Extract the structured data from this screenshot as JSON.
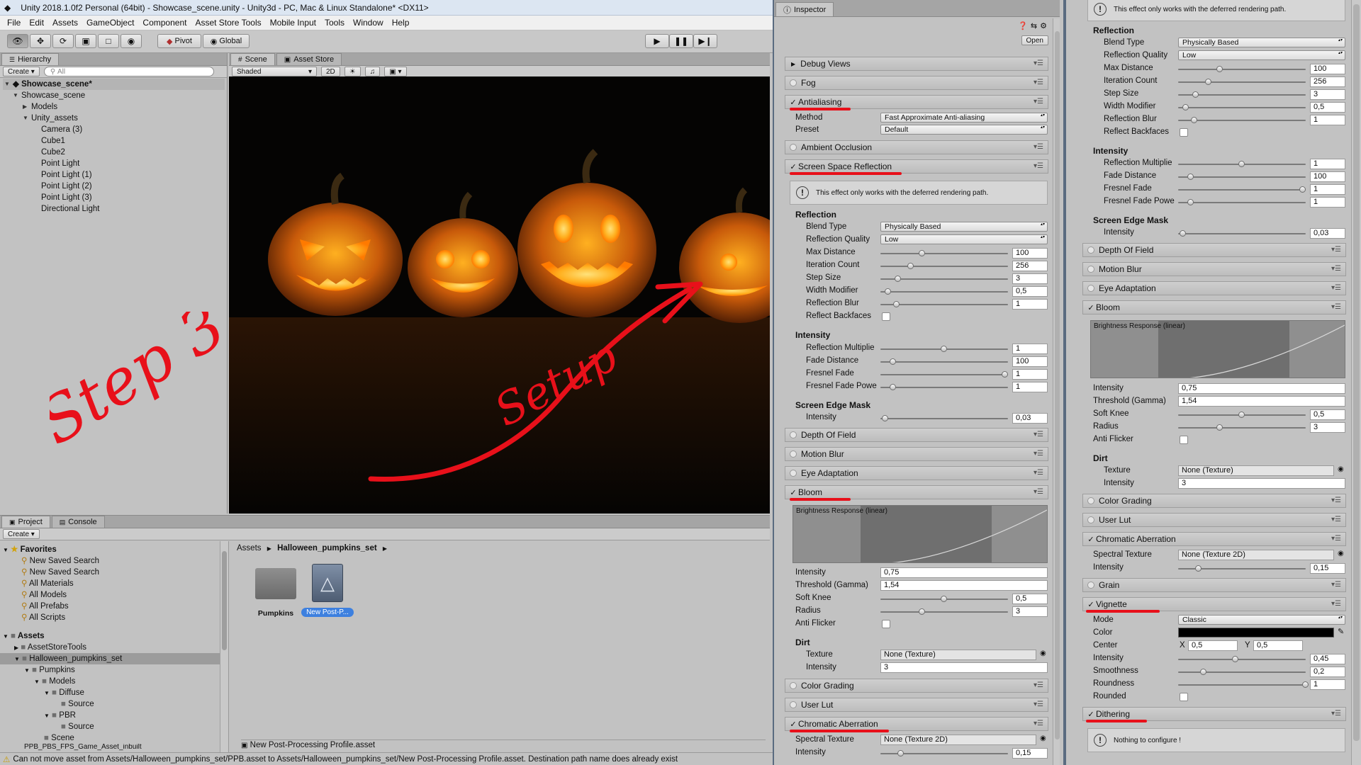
{
  "window": {
    "title": "Unity 2018.1.0f2 Personal (64bit) - Showcase_scene.unity - Unity3d - PC, Mac & Linux Standalone* <DX11>"
  },
  "menu": [
    "File",
    "Edit",
    "Assets",
    "GameObject",
    "Component",
    "Asset Store Tools",
    "Mobile Input",
    "Tools",
    "Window",
    "Help"
  ],
  "toolbar": {
    "pivot": "Pivot",
    "global": "Global"
  },
  "hierarchy": {
    "tab": "Hierarchy",
    "create": "Create",
    "search_placeholder": "All",
    "scene": "Showcase_scene*",
    "items": [
      "Showcase_scene",
      "Models",
      "Unity_assets",
      "Camera (3)",
      "Cube1",
      "Cube2",
      "Point Light",
      "Point Light (1)",
      "Point Light (2)",
      "Point Light (3)",
      "Directional Light"
    ]
  },
  "scene": {
    "tab_scene": "Scene",
    "tab_store": "Asset Store",
    "shading": "Shaded",
    "mode2d": "2D"
  },
  "annotations": {
    "step": "Step 3",
    "setup": "Setup"
  },
  "project": {
    "tab_project": "Project",
    "tab_console": "Console",
    "create": "Create",
    "favorites_title": "Favorites",
    "favorites": [
      "New Saved Search",
      "New Saved Search",
      "All Materials",
      "All Models",
      "All Prefabs",
      "All Scripts"
    ],
    "assets_title": "Assets",
    "tree": [
      "AssetStoreTools",
      "Halloween_pumpkins_set",
      "Pumpkins",
      "Models",
      "Diffuse",
      "Source",
      "PBR",
      "Source",
      "Scene",
      "PPB_PBS_FPS_Game_Asset_inbuilt"
    ],
    "breadcrumb": [
      "Assets",
      "Halloween_pumpkins_set"
    ],
    "files": [
      "Pumpkins",
      "New Post-P..."
    ],
    "selected_file": "New Post-Processing Profile.asset"
  },
  "status": "Can not move asset from Assets/Halloween_pumpkins_set/PPB.asset to Assets/Halloween_pumpkins_set/New Post-Processing Profile.asset. Destination path name does already exist",
  "inspector": {
    "tab": "Inspector",
    "open": "Open",
    "effects": {
      "debug_views": "Debug Views",
      "fog": "Fog",
      "antialiasing": "Antialiasing",
      "ambient_occlusion": "Ambient Occlusion",
      "ssr": "Screen Space Reflection",
      "dof": "Depth Of Field",
      "motion_blur": "Motion Blur",
      "eye_adaptation": "Eye Adaptation",
      "bloom": "Bloom",
      "color_grading": "Color Grading",
      "user_lut": "User Lut",
      "chromatic_aberration": "Chromatic Aberration",
      "grain": "Grain",
      "vignette": "Vignette",
      "dithering": "Dithering"
    },
    "aa": {
      "method_label": "Method",
      "method": "Fast Approximate Anti-aliasing",
      "preset_label": "Preset",
      "preset": "Default"
    },
    "deferred_note": "This effect only works with the deferred rendering path.",
    "nothing_note": "Nothing to configure !",
    "ssr": {
      "reflection_title": "Reflection",
      "blend_type_label": "Blend Type",
      "blend_type": "Physically Based",
      "quality_label": "Reflection Quality",
      "quality": "Low",
      "max_distance_label": "Max Distance",
      "max_distance": "100",
      "iteration_count_label": "Iteration Count",
      "iteration_count": "256",
      "step_size_label": "Step Size",
      "step_size": "3",
      "width_modifier_label": "Width Modifier",
      "width_modifier": "0,5",
      "reflection_blur_label": "Reflection Blur",
      "reflection_blur": "1",
      "reflect_backfaces_label": "Reflect Backfaces",
      "intensity_title": "Intensity",
      "reflection_multiplier_label": "Reflection Multiplie",
      "reflection_multiplier": "1",
      "fade_distance_label": "Fade Distance",
      "fade_distance": "100",
      "fresnel_fade_label": "Fresnel Fade",
      "fresnel_fade": "1",
      "fresnel_fade_power_label": "Fresnel Fade Powe",
      "fresnel_fade_power": "1",
      "edge_title": "Screen Edge Mask",
      "edge_intensity_label": "Intensity",
      "edge_intensity": "0,03",
      "sliders": {
        "max_distance": 0.33,
        "iteration_count": 0.24,
        "step_size": 0.14,
        "width_modifier": 0.06,
        "reflection_blur": 0.13,
        "reflection_multiplier": 0.5,
        "fade_distance": 0.1,
        "fresnel_fade": 0.98,
        "fresnel_fade_power": 0.1,
        "edge_intensity": 0.04
      }
    },
    "bloom": {
      "curve_title": "Brightness Response (linear)",
      "intensity_label": "Intensity",
      "intensity": "0,75",
      "threshold_label": "Threshold (Gamma)",
      "threshold": "1,54",
      "soft_knee_label": "Soft Knee",
      "soft_knee": "0,5",
      "radius_label": "Radius",
      "radius": "3",
      "anti_flicker_label": "Anti Flicker",
      "dirt_title": "Dirt",
      "texture_label": "Texture",
      "texture": "None (Texture)",
      "dirt_intensity_label": "Intensity",
      "dirt_intensity": "3",
      "sliders": {
        "soft_knee": 0.5,
        "radius": 0.33
      }
    },
    "chromatic": {
      "texture_label": "Spectral Texture",
      "texture": "None (Texture 2D)",
      "intensity_label": "Intensity",
      "intensity": "0,15",
      "slider": 0.16
    },
    "vignette": {
      "mode_label": "Mode",
      "mode": "Classic",
      "color_label": "Color",
      "color": "#000000",
      "center_label": "Center",
      "x_label": "X",
      "x": "0,5",
      "y_label": "Y",
      "y": "0,5",
      "intensity_label": "Intensity",
      "intensity": "0,45",
      "smoothness_label": "Smoothness",
      "smoothness": "0,2",
      "roundness_label": "Roundness",
      "roundness": "1",
      "rounded_label": "Rounded",
      "sliders": {
        "intensity": 0.45,
        "smoothness": 0.2,
        "roundness": 1.0
      }
    }
  },
  "colors": {
    "annotation_red": "#e8101a",
    "selection_blue": "#3d80df",
    "viewport_bg": "#050403",
    "pumpkin_glow": "#ffb020"
  }
}
